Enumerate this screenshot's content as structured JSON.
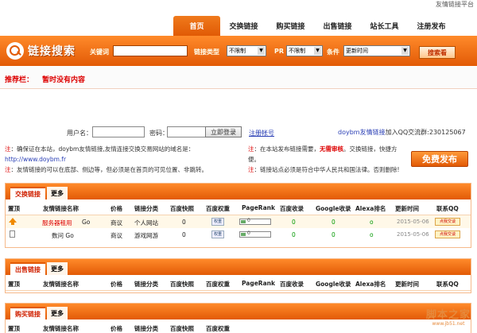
{
  "top_right": "友情链接平台",
  "nav": [
    "首页",
    "交换链接",
    "购买链接",
    "出售链接",
    "站长工具",
    "注册发布"
  ],
  "logo_text": "链接搜索",
  "search": {
    "keyword_label": "关键词",
    "type_label": "链接类型",
    "type_value": "不限制",
    "pr_label": "PR",
    "pr_value": "不限制",
    "cond_label": "条件",
    "cond_value": "更新时间",
    "button": "搜索看"
  },
  "recommend": {
    "label": "推荐栏：",
    "text": "暂时没有内容"
  },
  "login": {
    "user_label": "用户名：",
    "pwd_label": "密码：",
    "login_btn": "立即登录",
    "register": "注册帐号",
    "qq_link": "doybm友情链接",
    "qq_text": "加入QQ交流群:230125067"
  },
  "notices": {
    "left1_red": "注",
    "left1": "：确保证在本站，doybm友情链接,友情连接交换交易网站的域名是：",
    "left_url": "http://www.doybm.fr",
    "left2_red": "注",
    "left2": "：友情链接的可以在底部、侧边等，但必须是在首页的可见位置、非跳转。",
    "right1_red": "注",
    "right1a": "：在本站发布链接需要，",
    "right1_bold": "无需审核",
    "right1b": "。交换链接，快捷方",
    "right1c": "便。",
    "right2_red": "注",
    "right2": "：链接站点必须是符合中华人民共和国法律。否则删除!"
  },
  "free_button": "免费发布",
  "columns": [
    "置顶",
    "友情链接名称",
    "价格",
    "链接分类",
    "百度快照",
    "百度权重",
    "PageRank",
    "百度收录",
    "Google收录",
    "Alexa排名",
    "更新时间",
    "联系QQ"
  ],
  "panels": [
    {
      "tab": "交换链接",
      "more": "更多",
      "rows": [
        {
          "name_red": "服务器租用",
          "name": "Go",
          "price": "商议",
          "category": "个人网站",
          "snapshot": "0",
          "weight_badge": "权重",
          "pr": "0",
          "baidu": "0",
          "google": "0",
          "alexa": "o",
          "date": "2015-05-06",
          "qq": "点我交谈"
        },
        {
          "name_red": "",
          "name": "数问 Go",
          "price": "商议",
          "category": "游戏网游",
          "snapshot": "0",
          "weight_badge": "权重",
          "pr": "0",
          "baidu": "0",
          "google": "0",
          "alexa": "o",
          "date": "2015-05-06",
          "qq": "点我交谈"
        }
      ]
    },
    {
      "tab": "出售链接",
      "more": "更多"
    },
    {
      "tab": "购买链接",
      "more": "更多"
    }
  ],
  "watermark": {
    "top": "脚本之家",
    "bottom": "www.jb51.net"
  }
}
